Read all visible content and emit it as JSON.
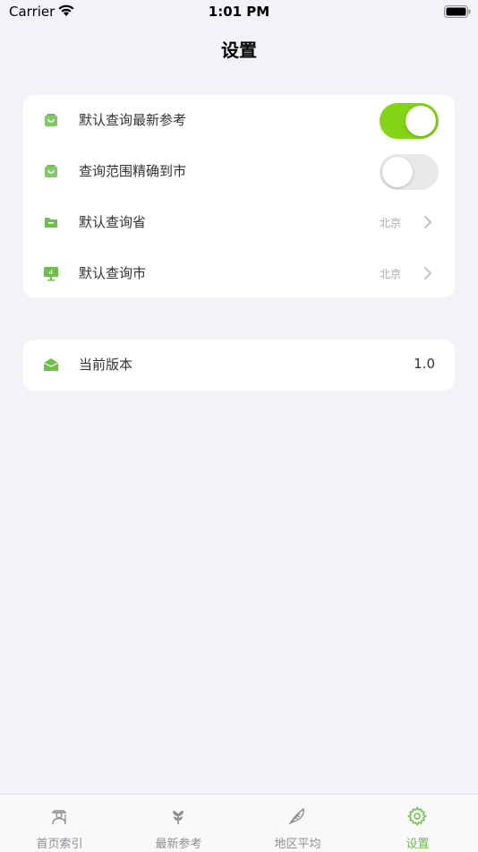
{
  "status_bar": {
    "carrier": "Carrier",
    "time": "1:01 PM"
  },
  "nav": {
    "title": "设置"
  },
  "settings": {
    "items": [
      {
        "label": "默认查询最新参考",
        "type": "toggle",
        "on": true,
        "icon": "bag-icon"
      },
      {
        "label": "查询范围精确到市",
        "type": "toggle",
        "on": false,
        "icon": "bag-icon"
      },
      {
        "label": "默认查询省",
        "type": "select",
        "value": "北京",
        "icon": "folder-icon"
      },
      {
        "label": "默认查询市",
        "type": "select",
        "value": "北京",
        "icon": "monitor-chart-icon"
      }
    ]
  },
  "about": {
    "label": "当前版本",
    "value": "1.0",
    "icon": "mail-icon"
  },
  "tabs": [
    {
      "label": "首页索引",
      "icon": "farmer-icon",
      "active": false
    },
    {
      "label": "最新参考",
      "icon": "sprout-icon",
      "active": false
    },
    {
      "label": "地区平均",
      "icon": "feather-icon",
      "active": false
    },
    {
      "label": "设置",
      "icon": "gear-icon",
      "active": true
    }
  ],
  "colors": {
    "accent": "#82d414",
    "icon_green": "#6cc04a",
    "background": "#f2f2f7"
  }
}
